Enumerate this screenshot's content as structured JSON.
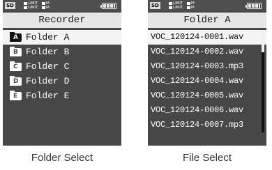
{
  "status": {
    "sd_label": "SD",
    "limit_top": "LIMIT",
    "limit_bottom": "LIMIT",
    "mode_top": "M",
    "mode_bottom": "M"
  },
  "folder_screen": {
    "title": "Recorder",
    "items": [
      {
        "icon": "A",
        "label": "Folder A",
        "selected": true
      },
      {
        "icon": "B",
        "label": "Folder B",
        "selected": false
      },
      {
        "icon": "C",
        "label": "Folder C",
        "selected": false
      },
      {
        "icon": "D",
        "label": "Folder D",
        "selected": false
      },
      {
        "icon": "E",
        "label": "Folder E",
        "selected": false
      }
    ],
    "caption": "Folder Select"
  },
  "file_screen": {
    "title": "Folder A",
    "items": [
      {
        "label": "VOC_120124-0001.wav",
        "selected": true
      },
      {
        "label": "VOC_120124-0002.wav",
        "selected": false
      },
      {
        "label": "VOC_120124-0003.mp3",
        "selected": false
      },
      {
        "label": "VOC_120124-0004.wav",
        "selected": false
      },
      {
        "label": "VOC_120124-0005.wav",
        "selected": false
      },
      {
        "label": "VOC_120124-0006.wav",
        "selected": false
      },
      {
        "label": "VOC_120124-0007.mp3",
        "selected": false
      }
    ],
    "caption": "File Select"
  }
}
